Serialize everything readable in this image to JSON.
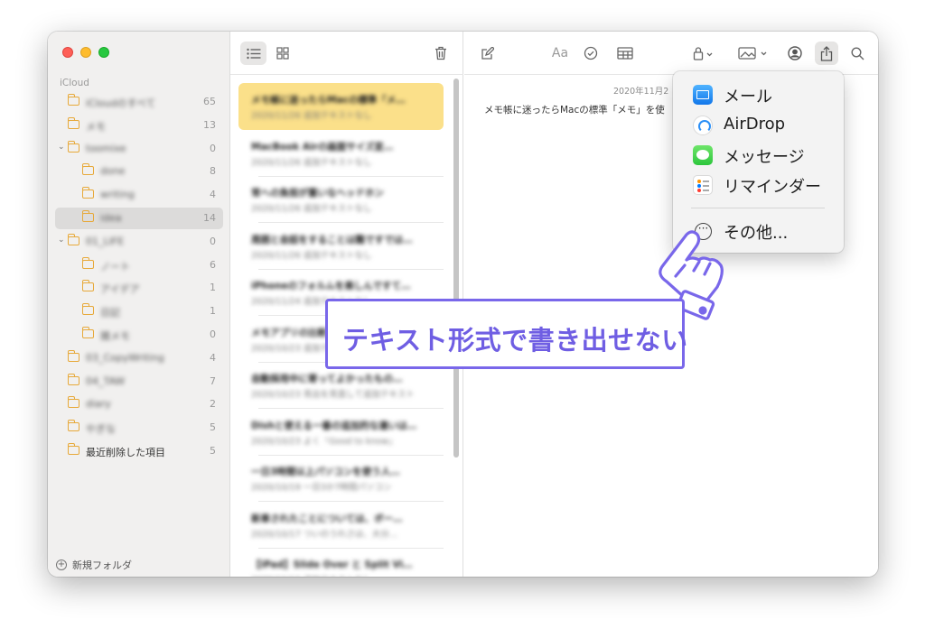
{
  "sidebar": {
    "section": "iCloud",
    "folders": [
      {
        "name": "iCloudのすべて",
        "count": "65",
        "blurred": true
      },
      {
        "name": "メモ",
        "count": "13",
        "blurred": true
      },
      {
        "name": "toomixe",
        "count": "0",
        "blurred": true
      },
      {
        "name": "done",
        "count": "8",
        "blurred": true
      },
      {
        "name": "writing",
        "count": "4",
        "blurred": true
      },
      {
        "name": "idea",
        "count": "14",
        "blurred": true
      },
      {
        "name": "01_LIFE",
        "count": "0",
        "blurred": true
      },
      {
        "name": "ノート",
        "count": "6",
        "blurred": true
      },
      {
        "name": "アイデア",
        "count": "1",
        "blurred": true
      },
      {
        "name": "日記",
        "count": "1",
        "blurred": true
      },
      {
        "name": "雑メモ",
        "count": "0",
        "blurred": true
      },
      {
        "name": "03_CopyWriting",
        "count": "4",
        "blurred": true
      },
      {
        "name": "04_TAW",
        "count": "7",
        "blurred": true
      },
      {
        "name": "diary",
        "count": "2",
        "blurred": true
      },
      {
        "name": "やぎな",
        "count": "5",
        "blurred": true
      },
      {
        "name": "最近削除した項目",
        "count": "5",
        "blurred": false
      }
    ],
    "new_folder": "新規フォルダ"
  },
  "notes": [
    {
      "title": "メモ帳に迷ったらMacの標準「メ…",
      "sub": "2020/11/26  追加テキストなし"
    },
    {
      "title": "MacBook Airの画面サイズ変…",
      "sub": "2020/11/26  追加テキストなし"
    },
    {
      "title": "常への負担が重いなヘッドホン",
      "sub": "2020/11/26  追加テキストなし"
    },
    {
      "title": "周囲と会話をすることは難ですでは…",
      "sub": "2020/11/26  追加テキストなし"
    },
    {
      "title": "iPhoneのフォルムを楽しんですて…",
      "sub": "2020/11/24  追加テキストなし"
    },
    {
      "title": "メモアプリの比較と選び方の…",
      "sub": "2020/10/23  追加テキストなし"
    },
    {
      "title": "自動採用中に寄ってよかったもの…",
      "sub": "2020/10/23  見出を見直して追加テキスト"
    },
    {
      "title": "Dishと使える一番の追加的な違いは…",
      "sub": "2020/10/23  よく「Good to know」"
    },
    {
      "title": "一日3時間以上パソコンを使う人…",
      "sub": "2020/10/19  一日3か7時間パソコン"
    },
    {
      "title": "新車されたことについては、ボー…",
      "sub": "2020/10/17  ついのうれさは、大分…"
    },
    {
      "title": "【iPad】Slide Over と Split Vi…",
      "sub": "2020/10/16  追加テキストなし"
    }
  ],
  "editor": {
    "date": "2020年11月2",
    "body": "メモ帳に迷ったらMacの標準「メモ」を使",
    "format_label": "Aa"
  },
  "share_menu": {
    "items": [
      {
        "label": "メール",
        "icon": "mail-icon"
      },
      {
        "label": "AirDrop",
        "icon": "airdrop-icon"
      },
      {
        "label": "メッセージ",
        "icon": "messages-icon"
      },
      {
        "label": "リマインダー",
        "icon": "reminders-icon"
      }
    ],
    "more": "その他..."
  },
  "callout": {
    "text": "テキスト形式で書き出せない"
  },
  "colors": {
    "accent": "#6f5ee3",
    "selected_note": "#fbe08a",
    "folder": "#e7a93a",
    "sidebar_bg": "#f1f0ef"
  }
}
